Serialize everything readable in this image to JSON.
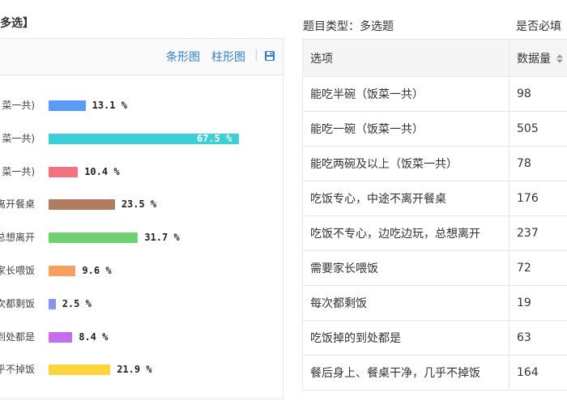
{
  "page_title": "多选】",
  "toolbar": {
    "bar_chart_label": "条形图",
    "column_chart_label": "柱形图",
    "separator": "|"
  },
  "colors": {
    "link": "#2f7dd6"
  },
  "chart_data": {
    "type": "bar",
    "orientation": "horizontal",
    "categories": [
      "菜一共)",
      "菜一共)",
      "菜一共)",
      "离开餐桌",
      "总想离开",
      "家长喂饭",
      "次都剩饭",
      "到处都是",
      "乎不掉饭"
    ],
    "values": [
      13.1,
      67.5,
      10.4,
      23.5,
      31.7,
      9.6,
      2.5,
      8.4,
      21.9
    ],
    "value_labels": [
      "13.1 %",
      "67.5 %",
      "10.4 %",
      "23.5 %",
      "31.7 %",
      "9.6 %",
      "2.5 %",
      "8.4 %",
      "21.9 %"
    ],
    "colors": [
      "#5b9bf8",
      "#3ccfd8",
      "#f2727f",
      "#b07c5e",
      "#6fd16f",
      "#f79f5e",
      "#8b93ef",
      "#c56cf0",
      "#fcd43c"
    ],
    "unit": "%",
    "xlim": [
      0,
      67.5
    ]
  },
  "meta": {
    "question_type": "题目类型：多选题",
    "required": "是否必填"
  },
  "table": {
    "headers": [
      "选项",
      "数据量"
    ],
    "rows": [
      {
        "option": "能吃半碗（饭菜一共）",
        "count": "98"
      },
      {
        "option": "能吃一碗（饭菜一共）",
        "count": "505"
      },
      {
        "option": "能吃两碗及以上（饭菜一共）",
        "count": "78"
      },
      {
        "option": "吃饭专心，中途不离开餐桌",
        "count": "176"
      },
      {
        "option": "吃饭不专心，边吃边玩，总想离开",
        "count": "237"
      },
      {
        "option": "需要家长喂饭",
        "count": "72"
      },
      {
        "option": "每次都剩饭",
        "count": "19"
      },
      {
        "option": "吃饭掉的到处都是",
        "count": "63"
      },
      {
        "option": "餐后身上、餐桌干净，几乎不掉饭",
        "count": "164"
      }
    ]
  }
}
